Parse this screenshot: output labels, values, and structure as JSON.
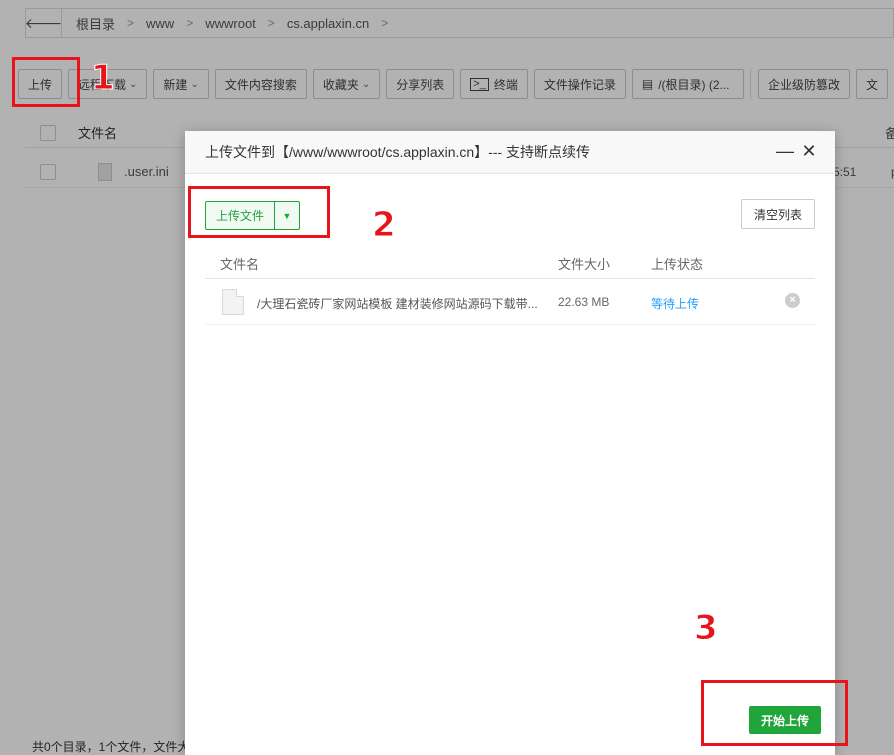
{
  "breadcrumb": {
    "items": [
      "根目录",
      "www",
      "wwwroot",
      "cs.applaxin.cn"
    ]
  },
  "toolbar": {
    "upload": "上传",
    "remote_download": "远程下载",
    "new": "新建",
    "content_search": "文件内容搜索",
    "favorites": "收藏夹",
    "share_list": "分享列表",
    "terminal": "终端",
    "op_log": "文件操作记录",
    "root_disk": "/(根目录) (2...",
    "enterprise_protect": "企业级防篡改",
    "file_sync": "文"
  },
  "file_table": {
    "name_header": "文件名",
    "right_header": "备",
    "rows": [
      {
        "name": ".user.ini",
        "time": "5:51",
        "perm": "p"
      }
    ]
  },
  "footer": {
    "summary": "共0个目录，1个文件，文件大"
  },
  "dialog": {
    "title": "上传文件到【/www/wwwroot/cs.applaxin.cn】--- 支持断点续传",
    "minimize": "—",
    "close": "✕",
    "upload_file_btn": "上传文件",
    "clear_list_btn": "清空列表",
    "columns": {
      "name": "文件名",
      "size": "文件大小",
      "status": "上传状态"
    },
    "files": [
      {
        "name": "/大理石瓷砖厂家网站模板 建材装修网站源码下载带...",
        "size": "22.63 MB",
        "status": "等待上传"
      }
    ],
    "start_upload_btn": "开始上传"
  },
  "annotations": {
    "one": "1",
    "two": "2",
    "three": "3"
  },
  "colors": {
    "primary_green": "#20a53a",
    "link_blue": "#20a0ff",
    "annotation_red": "#e8141b"
  }
}
